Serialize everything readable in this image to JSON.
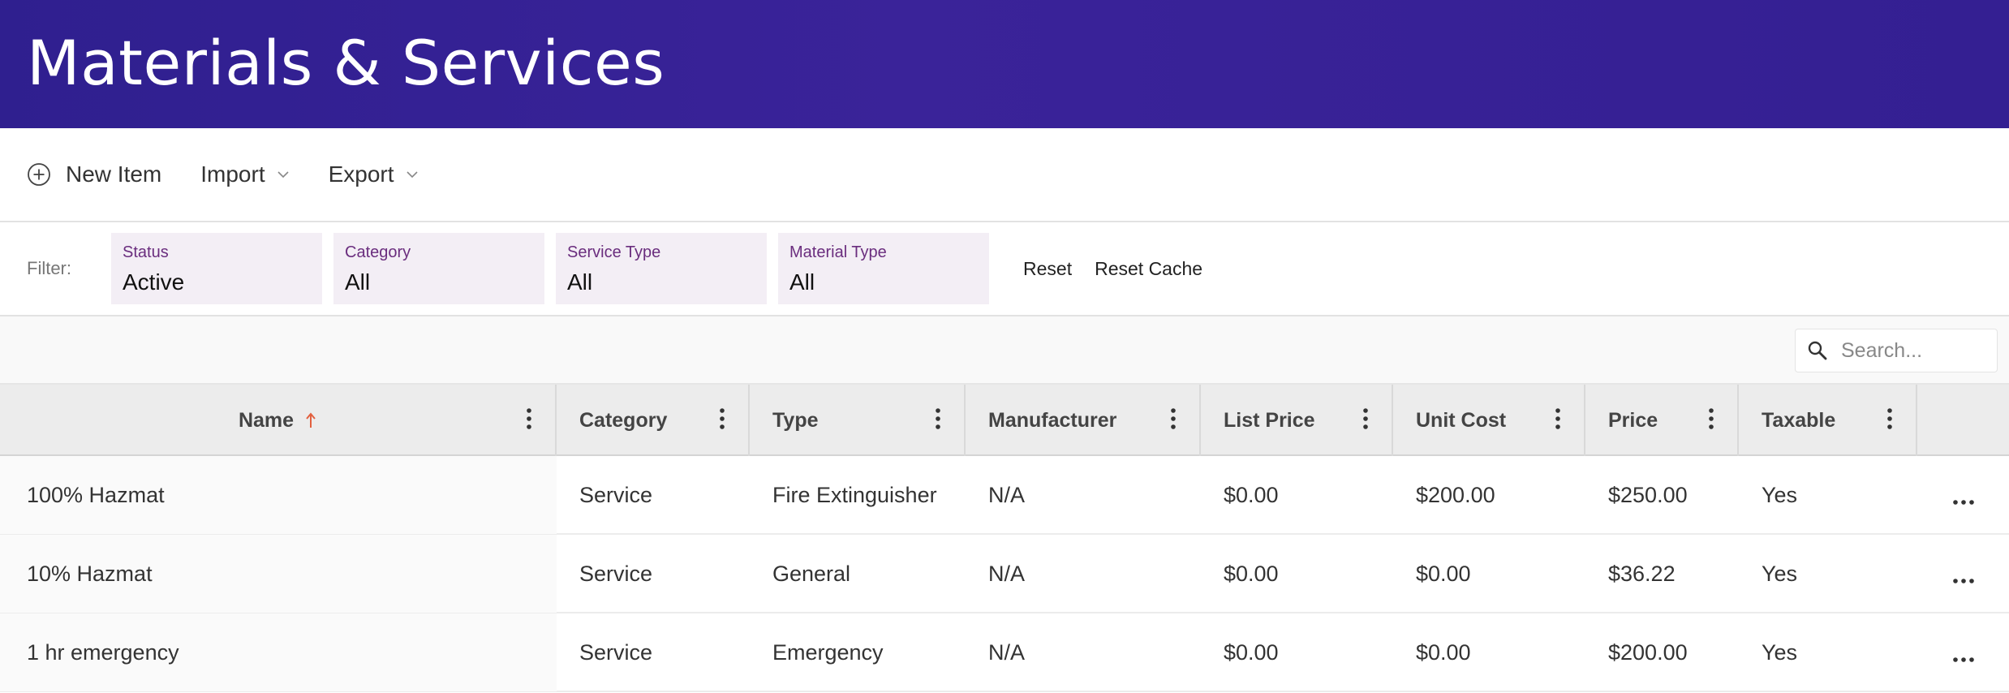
{
  "header": {
    "title": "Materials & Services"
  },
  "toolbar": {
    "new_item": "New Item",
    "import": "Import",
    "export": "Export"
  },
  "filters": {
    "label": "Filter:",
    "status": {
      "label": "Status",
      "value": "Active"
    },
    "category": {
      "label": "Category",
      "value": "All"
    },
    "service_type": {
      "label": "Service Type",
      "value": "All"
    },
    "material_type": {
      "label": "Material Type",
      "value": "All"
    },
    "reset": "Reset",
    "reset_cache": "Reset Cache"
  },
  "search": {
    "placeholder": "Search..."
  },
  "table": {
    "sort": {
      "column": "Name",
      "direction": "ascending",
      "indicator_color": "#e2603f"
    },
    "columns": {
      "name": "Name",
      "category": "Category",
      "type": "Type",
      "manufacturer": "Manufacturer",
      "list_price": "List Price",
      "unit_cost": "Unit Cost",
      "price": "Price",
      "taxable": "Taxable"
    },
    "rows": [
      {
        "name": "100% Hazmat",
        "category": "Service",
        "type": "Fire Extinguisher",
        "manufacturer": "N/A",
        "list_price": "$0.00",
        "unit_cost": "$200.00",
        "price": "$250.00",
        "taxable": "Yes"
      },
      {
        "name": "10% Hazmat",
        "category": "Service",
        "type": "General",
        "manufacturer": "N/A",
        "list_price": "$0.00",
        "unit_cost": "$0.00",
        "price": "$36.22",
        "taxable": "Yes"
      },
      {
        "name": "1 hr emergency",
        "category": "Service",
        "type": "Emergency",
        "manufacturer": "N/A",
        "list_price": "$0.00",
        "unit_cost": "$0.00",
        "price": "$200.00",
        "taxable": "Yes"
      }
    ]
  },
  "colors": {
    "header_bg": "#34208f",
    "filter_bg": "#f3eef5",
    "filter_label": "#6a2d7e",
    "sort_arrow": "#e2603f"
  }
}
